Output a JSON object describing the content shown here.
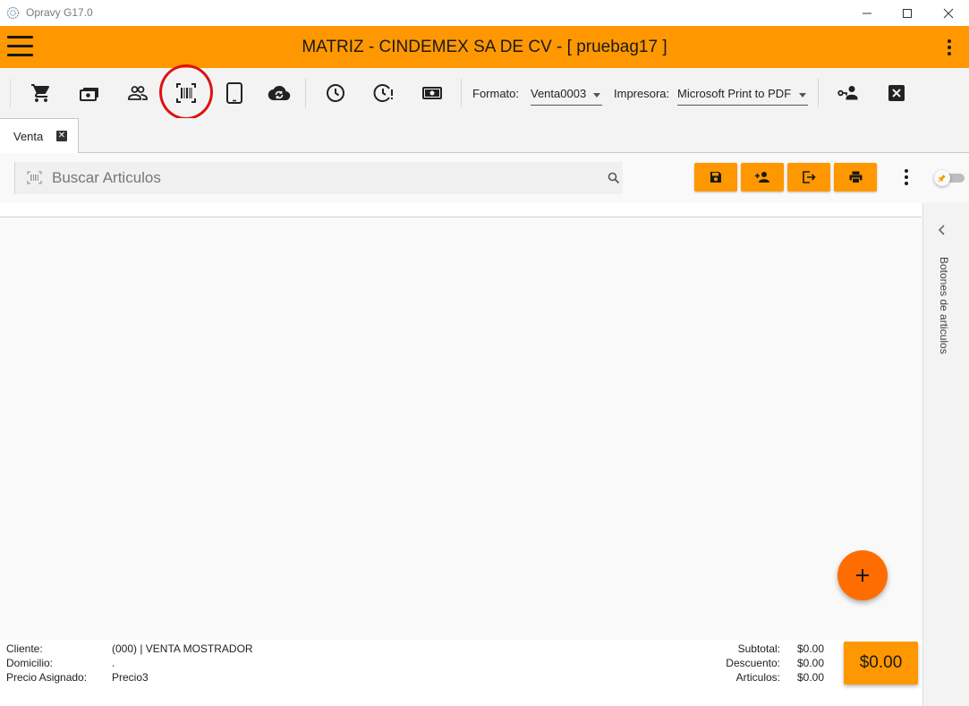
{
  "window": {
    "title": "Opravy G17.0",
    "icons": [
      "app-logo-icon",
      "minimize-icon",
      "maximize-icon",
      "close-icon"
    ]
  },
  "appbar": {
    "title": "MATRIZ - CINDEMEX SA DE CV - [ pruebag17 ]",
    "icons": [
      "hamburger-menu-icon",
      "more-vertical-icon"
    ]
  },
  "toolbar": {
    "icons": [
      "shopping-cart-icon",
      "cash-icon",
      "people-icon",
      "barcode-scan-icon",
      "tablet-icon",
      "cloud-sync-icon",
      "clock-icon",
      "clock-alert-icon",
      "money-bill-icon",
      "user-key-icon",
      "close-box-icon"
    ],
    "formato_label": "Formato:",
    "formato_value": "Venta0003",
    "impresora_label": "Impresora:",
    "impresora_value": "Microsoft Print to PDF"
  },
  "tabs": [
    {
      "label": "Venta",
      "active": true
    }
  ],
  "search": {
    "placeholder": "Buscar Articulos"
  },
  "actions": {
    "icons": [
      "save-icon",
      "add-user-icon",
      "exit-icon",
      "print-icon",
      "more-vertical-icon",
      "pin-toggle-icon"
    ]
  },
  "side_panel": {
    "label": "Botones de articulos"
  },
  "fab": {
    "icon": "plus-icon"
  },
  "footer": {
    "cliente_label": "Cliente:",
    "cliente_value": "(000) | VENTA MOSTRADOR",
    "domicilio_label": "Domicilio:",
    "domicilio_value": ".",
    "precio_label": "Precio Asignado:",
    "precio_value": "Precio3",
    "subtotal_label": "Subtotal:",
    "subtotal_value": "$0.00",
    "descuento_label": "Descuento:",
    "descuento_value": "$0.00",
    "articulos_label": "Articulos:",
    "articulos_value": "$0.00",
    "total": "$0.00"
  },
  "colors": {
    "accent": "#ff9800",
    "fab": "#ff6d00",
    "highlight": "#e01010"
  }
}
